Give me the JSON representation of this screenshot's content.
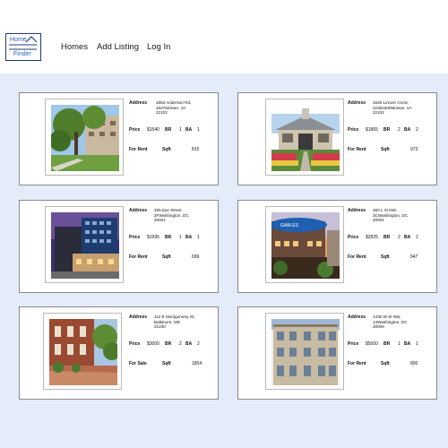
{
  "brand": {
    "line1": "Home",
    "line2": "Finder"
  },
  "nav": {
    "homes": "Homes",
    "add_listing": "Add Listing",
    "login": "Log In"
  },
  "labels": {
    "address": "Address",
    "price": "Price",
    "br": "BR",
    "ba": "BA",
    "sqft": "Sqft"
  },
  "listings": [
    {
      "address": [
        "1653 Anderson Rd,",
        "1647Mclean, VA",
        "22102"
      ],
      "price": "$1540",
      "br": "1",
      "ba": "1",
      "status": "For Rent",
      "sqft": "815"
    },
    {
      "address": [
        "1526 Lincoln Circle,",
        "22381500Mclean, VA",
        "22102"
      ],
      "price": "$1865",
      "br": "2",
      "ba": "2",
      "status": "For Rent",
      "sqft": "973"
    },
    {
      "address": [
        "455 Eye Street,",
        "2FWashington, DC",
        "20001"
      ],
      "price": "$1995",
      "br": "1",
      "ba": "1",
      "status": "For Rent",
      "sqft": "699"
    },
    {
      "address": [
        "460 L St NW,",
        "3CWashington, DC",
        "20001"
      ],
      "price": "$2825",
      "br": "2",
      "ba": "2",
      "status": "For Rent",
      "sqft": "947"
    },
    {
      "address": [
        "112 E Montgomery St,",
        "Baltimore, MD",
        "21230"
      ],
      "price": "$3000",
      "br": "2",
      "ba": "2",
      "status": "For Sale",
      "sqft": "1854"
    },
    {
      "address": [
        "1430 W St NW,",
        "14Washington, DC",
        "20009"
      ],
      "price": "$5000",
      "br": "1",
      "ba": "1",
      "status": "For Rent",
      "sqft": "800"
    }
  ],
  "photo_signs": {
    "gables": "GABLES"
  }
}
